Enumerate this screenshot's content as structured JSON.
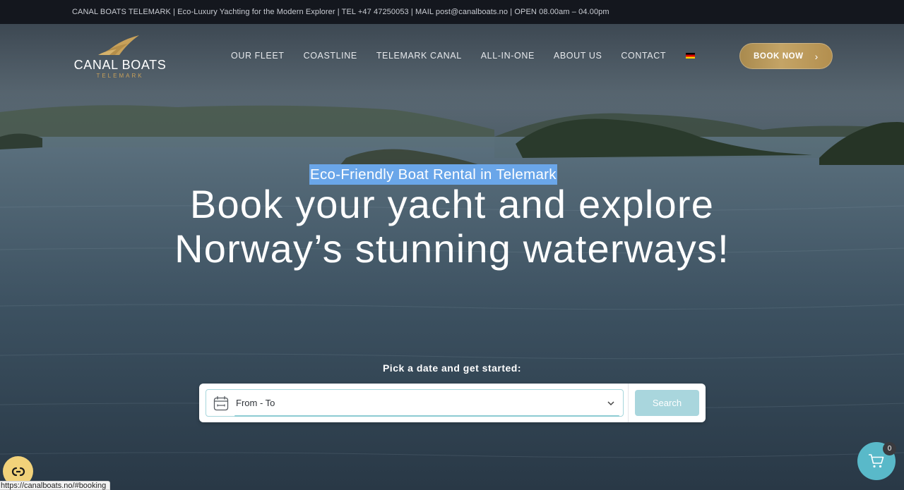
{
  "topbar": {
    "text": "CANAL BOATS TELEMARK | Eco-Luxury Yachting for the Modern Explorer | TEL +47 47250053 | MAIL post@canalboats.no | OPEN 08.00am – 04.00pm"
  },
  "brand": {
    "name": "CANAL BOATS",
    "subtitle": "TELEMARK"
  },
  "nav": {
    "items": [
      {
        "label": "OUR FLEET"
      },
      {
        "label": "COASTLINE"
      },
      {
        "label": "TELEMARK CANAL"
      },
      {
        "label": "ALL-IN-ONE"
      },
      {
        "label": "ABOUT US"
      },
      {
        "label": "CONTACT"
      }
    ],
    "language_icon": "german-flag-icon"
  },
  "cta": {
    "book_label": "BOOK NOW",
    "chevron": "›"
  },
  "hero": {
    "eyebrow": "Eco-Friendly Boat Rental in Telemark",
    "headline_line1": "Book your yacht and explore",
    "headline_line2": "Norway’s stunning waterways!"
  },
  "booking": {
    "prompt": "Pick a date and get started:",
    "date_value": "From - To",
    "search_label": "Search"
  },
  "widgets": {
    "cart_count": "0",
    "status_url": "https://canalboats.no/#booking"
  },
  "colors": {
    "gold": "#c4a466",
    "topbar_bg": "#14171e",
    "highlight": "#6aa6e9",
    "teal": "#59b9c9",
    "search_btn": "#a9d6dd",
    "cookie": "#f2d27a"
  }
}
